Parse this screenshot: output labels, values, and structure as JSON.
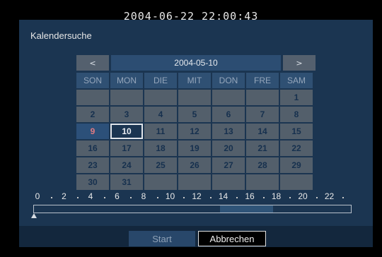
{
  "clock": "2004-06-22 22:00:43",
  "dialog": {
    "title": "Kalendersuche"
  },
  "calendar": {
    "prev_label": "<",
    "next_label": ">",
    "month_label": "2004-05-10",
    "weekdays": [
      "SON",
      "MON",
      "DIE",
      "MIT",
      "DON",
      "FRE",
      "SAM"
    ],
    "weeks": [
      [
        "",
        "",
        "",
        "",
        "",
        "",
        "1"
      ],
      [
        "2",
        "3",
        "4",
        "5",
        "6",
        "7",
        "8"
      ],
      [
        "9",
        "10",
        "11",
        "12",
        "13",
        "14",
        "15"
      ],
      [
        "16",
        "17",
        "18",
        "19",
        "20",
        "21",
        "22"
      ],
      [
        "23",
        "24",
        "25",
        "26",
        "27",
        "28",
        "29"
      ],
      [
        "30",
        "31",
        "",
        "",
        "",
        "",
        ""
      ]
    ],
    "highlighted_day": "9",
    "selected_day": "10"
  },
  "timeline": {
    "hours": [
      "0",
      "2",
      "4",
      "6",
      "8",
      "10",
      "12",
      "14",
      "16",
      "18",
      "20",
      "22"
    ],
    "recorded_range_hours": [
      14,
      18
    ]
  },
  "buttons": {
    "start": "Start",
    "cancel": "Abbrechen"
  }
}
